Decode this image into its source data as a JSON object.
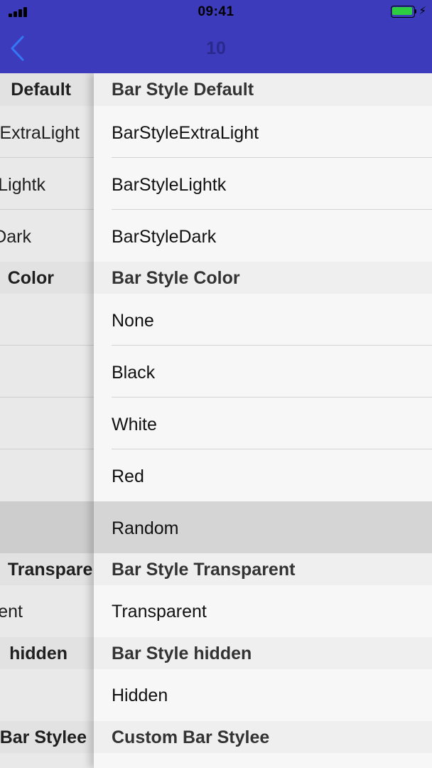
{
  "status_bar": {
    "time": "09:41",
    "icons": [
      "cellular-signal-icon",
      "battery-icon",
      "charging-bolt-icon"
    ],
    "battery_color": "#2ecc40"
  },
  "nav": {
    "title": "10",
    "back_icon": "chevron-left-icon",
    "bar_color": "#3c3bbb",
    "tint_color": "#3478f6"
  },
  "background_list": {
    "rows": [
      {
        "text": "Default",
        "header": true
      },
      {
        "text": "ExtraLight"
      },
      {
        "text": "Lightk"
      },
      {
        "text": "Dark"
      },
      {
        "text": "Color",
        "header": true
      },
      {
        "text": ""
      },
      {
        "text": ""
      },
      {
        "text": ""
      },
      {
        "text": ""
      },
      {
        "text": ""
      },
      {
        "text": "Transparent",
        "header": true
      },
      {
        "text": "ent"
      },
      {
        "text": "hidden",
        "header": true
      },
      {
        "text": ""
      },
      {
        "text": "Bar Stylee",
        "header": true
      }
    ]
  },
  "sections": [
    {
      "header": "Bar Style Default",
      "items": [
        "BarStyleExtraLight",
        "BarStyleLightk",
        "BarStyleDark"
      ]
    },
    {
      "header": "Bar Style Color",
      "items": [
        "None",
        "Black",
        "White",
        "Red",
        "Random"
      ],
      "selected_item": "Random"
    },
    {
      "header": "Bar Style Transparent",
      "items": [
        "Transparent"
      ]
    },
    {
      "header": "Bar Style hidden",
      "items": [
        "Hidden"
      ]
    },
    {
      "header": "Custom Bar Stylee",
      "items": []
    }
  ]
}
